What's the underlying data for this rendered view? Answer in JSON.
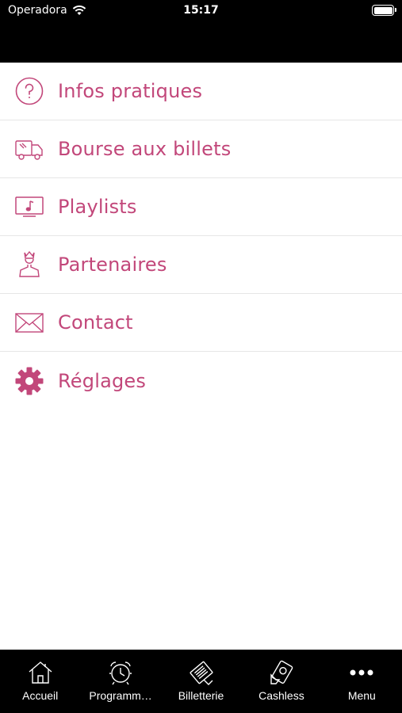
{
  "status_bar": {
    "carrier": "Operadora",
    "time": "15:17"
  },
  "menu": {
    "items": [
      {
        "label": "Infos pratiques",
        "icon": "question-circle-icon"
      },
      {
        "label": "Bourse aux billets",
        "icon": "truck-icon"
      },
      {
        "label": "Playlists",
        "icon": "music-screen-icon"
      },
      {
        "label": "Partenaires",
        "icon": "crowned-person-icon"
      },
      {
        "label": "Contact",
        "icon": "envelope-icon"
      },
      {
        "label": "Réglages",
        "icon": "gear-icon"
      }
    ]
  },
  "tabbar": {
    "items": [
      {
        "label": "Accueil",
        "icon": "home-icon"
      },
      {
        "label": "Programm…",
        "icon": "alarm-clock-icon"
      },
      {
        "label": "Billetterie",
        "icon": "ticket-icon"
      },
      {
        "label": "Cashless",
        "icon": "cashless-card-icon"
      },
      {
        "label": "Menu",
        "icon": "more-dots-icon"
      }
    ]
  },
  "colors": {
    "accent": "#c2477a",
    "header_bg": "#000000",
    "tabbar_bg": "#000000",
    "divider": "#e6e6e6",
    "background": "#ffffff"
  }
}
